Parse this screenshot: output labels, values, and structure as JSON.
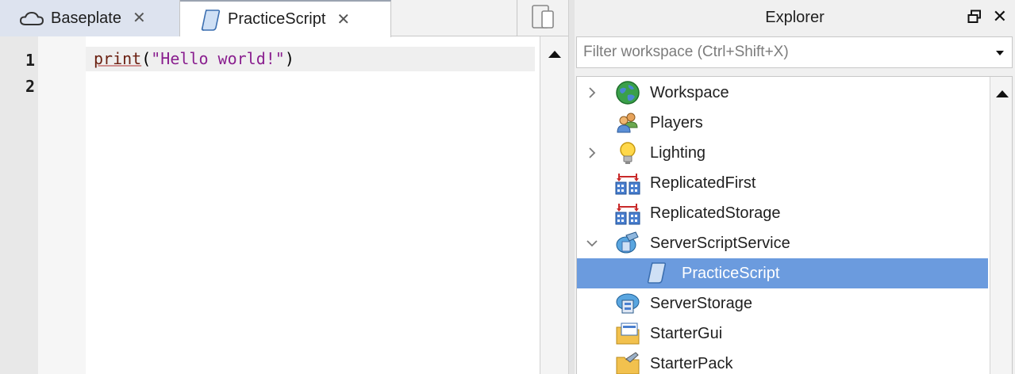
{
  "tabs": [
    {
      "label": "Baseplate",
      "icon": "cloud-icon"
    },
    {
      "label": "PracticeScript",
      "icon": "script-icon",
      "active": true
    }
  ],
  "editor": {
    "line_numbers": [
      "1",
      "2"
    ],
    "code": {
      "fn": "print",
      "open": "(",
      "str": "\"Hello world!\"",
      "close": ")"
    }
  },
  "explorer": {
    "title": "Explorer",
    "filter_placeholder": "Filter workspace (Ctrl+Shift+X)",
    "items": [
      {
        "label": "Workspace",
        "icon": "globe-icon",
        "expander": "collapsed",
        "indent": 0
      },
      {
        "label": "Players",
        "icon": "players-icon",
        "expander": "none",
        "indent": 0
      },
      {
        "label": "Lighting",
        "icon": "lightbulb-icon",
        "expander": "collapsed",
        "indent": 0
      },
      {
        "label": "ReplicatedFirst",
        "icon": "replicated-icon",
        "expander": "none",
        "indent": 0
      },
      {
        "label": "ReplicatedStorage",
        "icon": "replicated-icon",
        "expander": "none",
        "indent": 0
      },
      {
        "label": "ServerScriptService",
        "icon": "server-script-icon",
        "expander": "expanded",
        "indent": 0
      },
      {
        "label": "PracticeScript",
        "icon": "script-icon",
        "expander": "none",
        "indent": 1,
        "selected": true
      },
      {
        "label": "ServerStorage",
        "icon": "server-storage-icon",
        "expander": "none",
        "indent": 0
      },
      {
        "label": "StarterGui",
        "icon": "folder-gui-icon",
        "expander": "none",
        "indent": 0
      },
      {
        "label": "StarterPack",
        "icon": "folder-pack-icon",
        "expander": "none",
        "indent": 0
      }
    ]
  },
  "colors": {
    "selection": "#6b9bde",
    "string": "#8a1f8f",
    "function": "#6a1f10"
  }
}
